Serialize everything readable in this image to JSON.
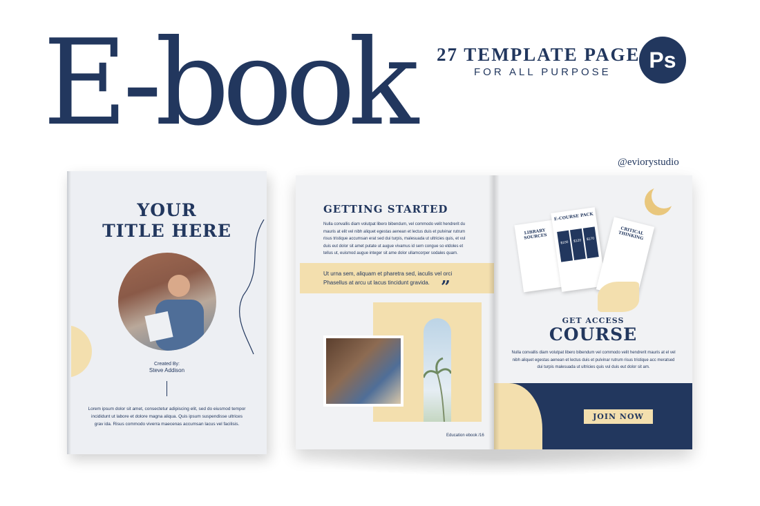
{
  "header": {
    "headline": "E-book",
    "tagline_line1": "27 TEMPLATE PAGES",
    "tagline_line2": "FOR ALL PURPOSE",
    "ps_badge": "Ps",
    "handle": "@eviorystudio"
  },
  "cover": {
    "title_line1": "YOUR",
    "title_line2": "TITLE HERE",
    "created_by_label": "Created By:",
    "author": "Steve Addison",
    "body": "Lorem ipsum dolor sit amet, consectetur adipiscing elit, sed do eiusmod tempor incididunt ut labore et dolore magna aliqua. Quis ipsum suspendisse ultrices grav ida. Risus commodo viverra maecenas accumsan lacus vel facilisis."
  },
  "left_page": {
    "title": "GETTING STARTED",
    "body": "Nulla convallis diam volutpat libero bibendum, vel commodo velit hendrerit du mauris at elit vel nibh aliquet egestas aenean et lectus duis et pulvinar rutrum risus tristique accumsan erat sed dui turpis, malesuada ut ultricies quis, et vul duis eut dolor sit amet putate ut augue vivamus id sem congue so etdoles et tellus ut, euismod augue integer sit ame dolor ullamcorper sodales quam.",
    "quote": "Ut urna sem, aliquam et pharetra sed, iaculis vel orci Phasellus at arcu ut lacus tincidunt gravida.",
    "quote_mark": "”",
    "footer": "Education ebook /16"
  },
  "right_page": {
    "mock_library": "LIBRARY SOURCES",
    "mock_course": "E-COURSE PACK",
    "mock_thinking": "CRITICAL THINKING",
    "prices": [
      "$100",
      "$120",
      "$170"
    ],
    "subtitle": "GET ACCESS",
    "title": "COURSE",
    "body": "Nulla convallis diam volutpat libero bibendum vel commodo velit hendrerit mauris at el vel nibh aliquet egestas aenean et lectus duis et pulvinar rutrum risus tristique acc meratsed dui turpis malesuada ut ultricies quis vul duis eut dolor sit am.",
    "cta": "JOIN NOW"
  },
  "colors": {
    "navy": "#22375e",
    "gold": "#f3dfae",
    "paper": "#f1f2f4"
  }
}
